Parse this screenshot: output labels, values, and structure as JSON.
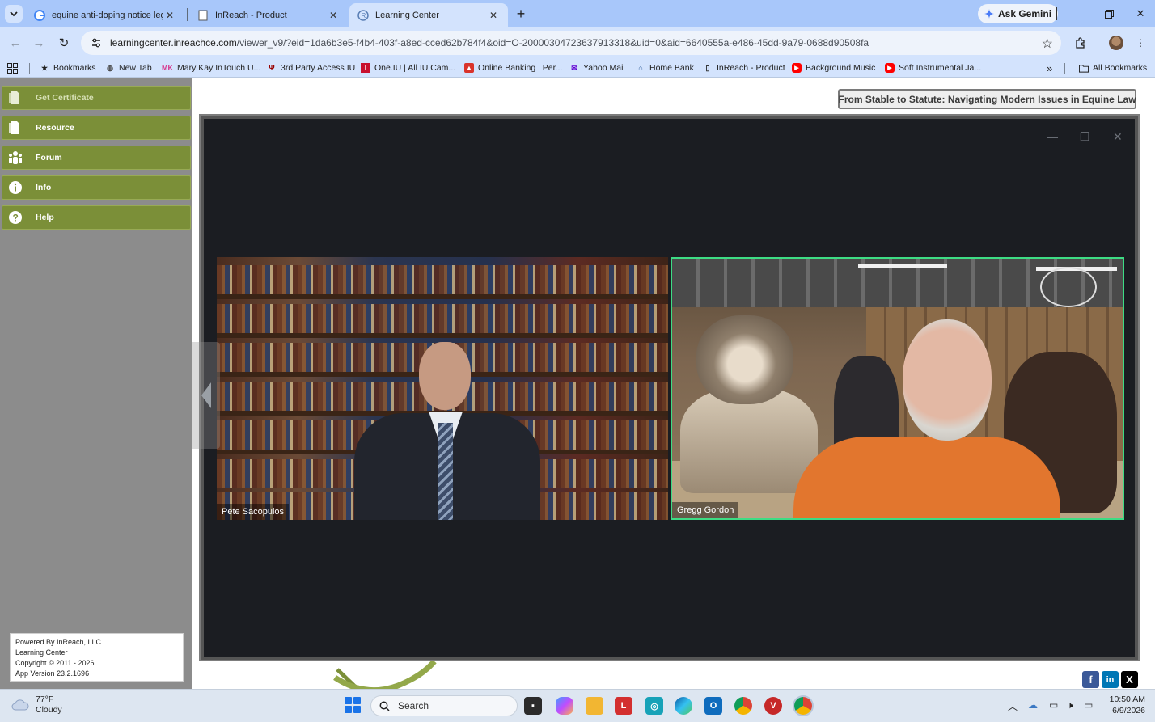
{
  "browser": {
    "tabs": [
      {
        "title": "equine anti-doping notice legal",
        "icon": "google-icon"
      },
      {
        "title": "InReach - Product",
        "icon": "page-icon"
      },
      {
        "title": "Learning Center",
        "icon": "inreach-icon",
        "active": true
      }
    ],
    "ask_gemini_label": "Ask Gemini",
    "url_host": "learningcenter.inreachce.com",
    "url_path": "/viewer_v9/?eid=1da6b3e5-f4b4-403f-a8ed-cced62b784f4&oid=O-20000304723637913318&uid=0&aid=6640555a-e486-45dd-9a79-0688d90508fa",
    "bookmarks": [
      {
        "label": "Bookmarks",
        "icon": "star-icon"
      },
      {
        "label": "New Tab",
        "icon": "globe-icon"
      },
      {
        "label": "Mary Kay InTouch U...",
        "icon": "mk-icon"
      },
      {
        "label": "3rd Party Access IU",
        "icon": "iu-icon"
      },
      {
        "label": "One.IU | All IU Cam...",
        "icon": "iu-red-icon"
      },
      {
        "label": "Online Banking | Per...",
        "icon": "bank-icon"
      },
      {
        "label": "Yahoo Mail",
        "icon": "mail-icon"
      },
      {
        "label": "Home Bank",
        "icon": "home-bank-icon"
      },
      {
        "label": "InReach - Product",
        "icon": "page-icon"
      },
      {
        "label": "Background Music",
        "icon": "youtube-icon"
      },
      {
        "label": "Soft Instrumental Ja...",
        "icon": "youtube-icon"
      }
    ],
    "all_bookmarks_label": "All Bookmarks"
  },
  "sidebar": {
    "items": [
      {
        "label": "Get Certificate",
        "icon": "certificate-icon"
      },
      {
        "label": "Resource",
        "icon": "book-icon"
      },
      {
        "label": "Forum",
        "icon": "people-icon"
      },
      {
        "label": "Info",
        "icon": "info-icon"
      },
      {
        "label": "Help",
        "icon": "help-icon"
      }
    ],
    "footer": {
      "line1": "Powered By InReach, LLC",
      "line2": "Learning Center",
      "line3": "Copyright © 2011 - 2026",
      "line4": "App Version 23.2.1696"
    }
  },
  "course": {
    "title": "From Stable to Statute: Navigating Modern Issues in Equine Law"
  },
  "video": {
    "participants": [
      {
        "name": "Pete Sacopulos"
      },
      {
        "name": "Gregg Gordon",
        "active_speaker": true
      }
    ]
  },
  "taskbar": {
    "weather_temp": "77°F",
    "weather_desc": "Cloudy",
    "search_placeholder": "Search",
    "time": "10:50 AM",
    "date": "6/9/2026"
  },
  "colors": {
    "sidebar_button": "#7b8f38",
    "sidebar_bg": "#8c8c8c",
    "active_speaker_border": "#3ddc84",
    "chrome_bg": "#d3e3fd"
  }
}
